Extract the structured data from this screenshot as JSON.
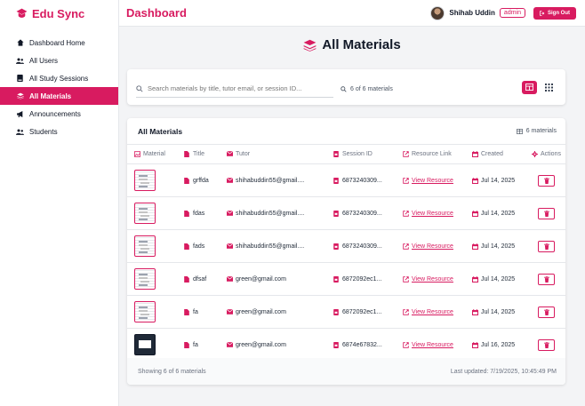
{
  "brand": {
    "name": "Edu Sync"
  },
  "sidebar": {
    "items": [
      {
        "label": "Dashboard Home",
        "icon": "home-icon",
        "active": false
      },
      {
        "label": "All Users",
        "icon": "users-icon",
        "active": false
      },
      {
        "label": "All Study Sessions",
        "icon": "book-icon",
        "active": false
      },
      {
        "label": "All Materials",
        "icon": "layers-icon",
        "active": true
      },
      {
        "label": "Announcements",
        "icon": "megaphone-icon",
        "active": false
      },
      {
        "label": "Students",
        "icon": "users-icon",
        "active": false
      }
    ]
  },
  "header": {
    "title": "Dashboard",
    "user_name": "Shihab Uddin",
    "role": "admin",
    "signout_label": "Sign Out"
  },
  "main": {
    "title": "All Materials"
  },
  "search": {
    "placeholder": "Search materials by title, tutor email, or session ID...",
    "count_text": "6 of 6 materials"
  },
  "table": {
    "title": "All Materials",
    "count_text": "6 materials",
    "columns": [
      "Material",
      "Title",
      "Tutor",
      "Session ID",
      "Resource Link",
      "Created",
      "Actions"
    ],
    "rows": [
      {
        "title": "grffda",
        "tutor": "shihabuddin55@gmail....",
        "session": "6873240309...",
        "link": "View Resource",
        "created": "Jul 14, 2025",
        "thumb": "doc"
      },
      {
        "title": "fdas",
        "tutor": "shihabuddin55@gmail....",
        "session": "6873240309...",
        "link": "View Resource",
        "created": "Jul 14, 2025",
        "thumb": "doc"
      },
      {
        "title": "fads",
        "tutor": "shihabuddin55@gmail....",
        "session": "6873240309...",
        "link": "View Resource",
        "created": "Jul 14, 2025",
        "thumb": "doc"
      },
      {
        "title": "dfsaf",
        "tutor": "green@gmail.com",
        "session": "6872092ec1...",
        "link": "View Resource",
        "created": "Jul 14, 2025",
        "thumb": "doc"
      },
      {
        "title": "fa",
        "tutor": "green@gmail.com",
        "session": "6872092ec1...",
        "link": "View Resource",
        "created": "Jul 14, 2025",
        "thumb": "doc"
      },
      {
        "title": "fa",
        "tutor": "green@gmail.com",
        "session": "6874e67832...",
        "link": "View Resource",
        "created": "Jul 16, 2025",
        "thumb": "screen"
      }
    ],
    "footer_showing": "Showing 6 of 6 materials",
    "footer_updated": "Last updated: 7/19/2025, 10:45:49 PM"
  },
  "colors": {
    "accent": "#d81b60",
    "background": "#f3f4f6"
  }
}
